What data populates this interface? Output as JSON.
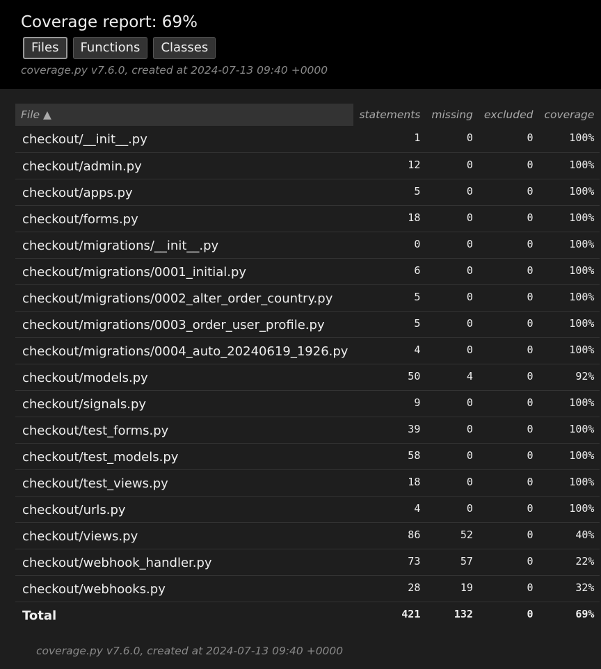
{
  "header": {
    "title": "Coverage report: 69%",
    "buttons": [
      "Files",
      "Functions",
      "Classes"
    ],
    "created": "coverage.py v7.6.0, created at 2024-07-13 09:40 +0000"
  },
  "table": {
    "columns": [
      "File ▲",
      "statements",
      "missing",
      "excluded",
      "coverage"
    ],
    "rows": [
      {
        "file": "checkout/__init__.py",
        "statements": "1",
        "missing": "0",
        "excluded": "0",
        "coverage": "100%"
      },
      {
        "file": "checkout/admin.py",
        "statements": "12",
        "missing": "0",
        "excluded": "0",
        "coverage": "100%"
      },
      {
        "file": "checkout/apps.py",
        "statements": "5",
        "missing": "0",
        "excluded": "0",
        "coverage": "100%"
      },
      {
        "file": "checkout/forms.py",
        "statements": "18",
        "missing": "0",
        "excluded": "0",
        "coverage": "100%"
      },
      {
        "file": "checkout/migrations/__init__.py",
        "statements": "0",
        "missing": "0",
        "excluded": "0",
        "coverage": "100%"
      },
      {
        "file": "checkout/migrations/0001_initial.py",
        "statements": "6",
        "missing": "0",
        "excluded": "0",
        "coverage": "100%"
      },
      {
        "file": "checkout/migrations/0002_alter_order_country.py",
        "statements": "5",
        "missing": "0",
        "excluded": "0",
        "coverage": "100%"
      },
      {
        "file": "checkout/migrations/0003_order_user_profile.py",
        "statements": "5",
        "missing": "0",
        "excluded": "0",
        "coverage": "100%"
      },
      {
        "file": "checkout/migrations/0004_auto_20240619_1926.py",
        "statements": "4",
        "missing": "0",
        "excluded": "0",
        "coverage": "100%"
      },
      {
        "file": "checkout/models.py",
        "statements": "50",
        "missing": "4",
        "excluded": "0",
        "coverage": "92%"
      },
      {
        "file": "checkout/signals.py",
        "statements": "9",
        "missing": "0",
        "excluded": "0",
        "coverage": "100%"
      },
      {
        "file": "checkout/test_forms.py",
        "statements": "39",
        "missing": "0",
        "excluded": "0",
        "coverage": "100%"
      },
      {
        "file": "checkout/test_models.py",
        "statements": "58",
        "missing": "0",
        "excluded": "0",
        "coverage": "100%"
      },
      {
        "file": "checkout/test_views.py",
        "statements": "18",
        "missing": "0",
        "excluded": "0",
        "coverage": "100%"
      },
      {
        "file": "checkout/urls.py",
        "statements": "4",
        "missing": "0",
        "excluded": "0",
        "coverage": "100%"
      },
      {
        "file": "checkout/views.py",
        "statements": "86",
        "missing": "52",
        "excluded": "0",
        "coverage": "40%"
      },
      {
        "file": "checkout/webhook_handler.py",
        "statements": "73",
        "missing": "57",
        "excluded": "0",
        "coverage": "22%"
      },
      {
        "file": "checkout/webhooks.py",
        "statements": "28",
        "missing": "19",
        "excluded": "0",
        "coverage": "32%"
      }
    ],
    "total": {
      "file": "Total",
      "statements": "421",
      "missing": "132",
      "excluded": "0",
      "coverage": "69%"
    }
  },
  "footer": {
    "created": "coverage.py v7.6.0, created at 2024-07-13 09:40 +0000"
  }
}
